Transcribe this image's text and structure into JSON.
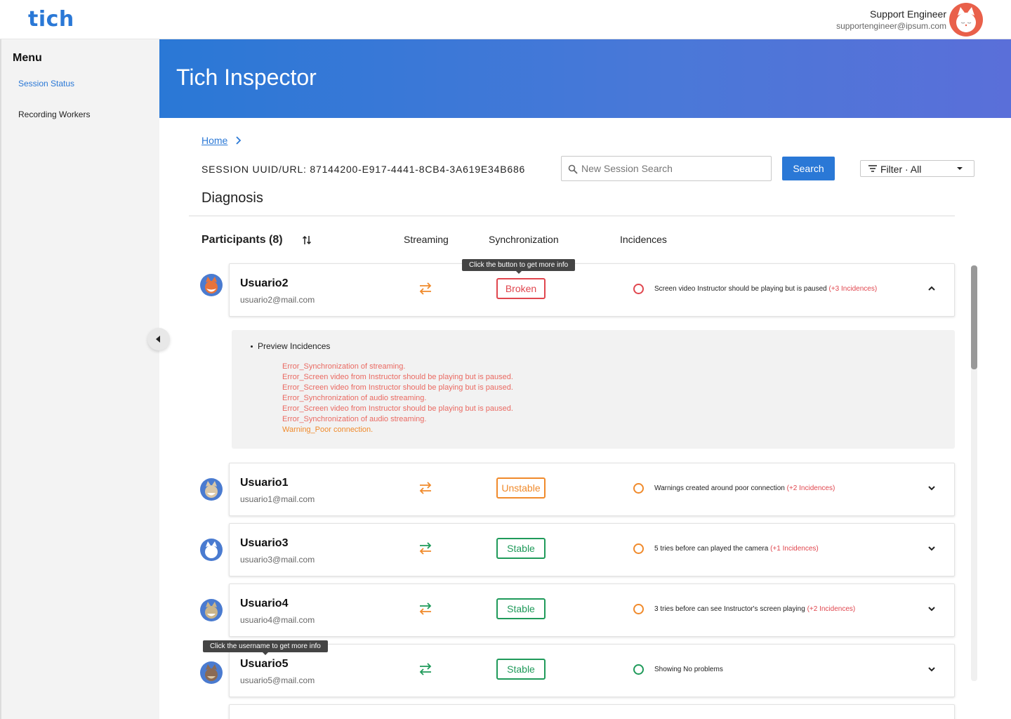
{
  "app": {
    "logo": "tich",
    "banner_title": "Tich Inspector"
  },
  "user": {
    "name": "Support Engineer",
    "email": "supportengineer@ipsum.com",
    "avatar": "cat-avatar"
  },
  "sidebar": {
    "title": "Menu",
    "items": [
      {
        "label": "Session Status",
        "active": true
      },
      {
        "label": "Recording Workers",
        "active": false
      }
    ]
  },
  "breadcrumb": {
    "home": "Home"
  },
  "session": {
    "label": "SESSION UUID/URL: 87144200-E917-4441-8CB4-3A619E34B686"
  },
  "search": {
    "placeholder": "New Session Search",
    "button": "Search"
  },
  "filter": {
    "label": "Filter · All"
  },
  "diagnosis": {
    "title": "Diagnosis"
  },
  "columns": {
    "participants": "Participants (8)",
    "streaming": "Streaming",
    "sync": "Synchronization",
    "incidences": "Incidences"
  },
  "tooltips": {
    "sync": "Click the button to get more info",
    "username": "Click the username to get more info"
  },
  "colors": {
    "accent": "#2a78d6",
    "broken": "#e0464e",
    "unstable": "#f08a2b",
    "stable": "#1f9a5a"
  },
  "participants": [
    {
      "name": "Usuario2",
      "email": "usuario2@mail.com",
      "sync": "Broken",
      "incidence": "Screen video Instructor should be playing but is paused",
      "count": "(+3 Incidences)"
    },
    {
      "name": "Usuario1",
      "email": "usuario1@mail.com",
      "sync": "Unstable",
      "incidence": "Warnings created around poor connection",
      "count": "(+2 Incidences)"
    },
    {
      "name": "Usuario3",
      "email": "usuario3@mail.com",
      "sync": "Stable",
      "incidence": "5 tries before can played the camera ",
      "count": "(+1 Incidences)"
    },
    {
      "name": "Usuario4",
      "email": "usuario4@mail.com",
      "sync": "Stable",
      "incidence": "3 tries before can see Instructor's screen playing",
      "count": "(+2 Incidences)"
    },
    {
      "name": "Usuario5",
      "email": "usuario5@mail.com",
      "sync": "Stable",
      "incidence": "Showing No problems",
      "count": ""
    }
  ],
  "preview": {
    "title": "Preview Incidences",
    "items": [
      "Error_Synchronization of streaming.",
      "Error_Screen video from Instructor should be playing but is paused.",
      "Error_Screen video from Instructor should be playing but is paused.",
      "Error_Synchronization of audio streaming.",
      "Error_Screen video from Instructor should be playing but is paused.",
      "Error_Synchronization of audio streaming.",
      "Warning_Poor connection."
    ]
  }
}
